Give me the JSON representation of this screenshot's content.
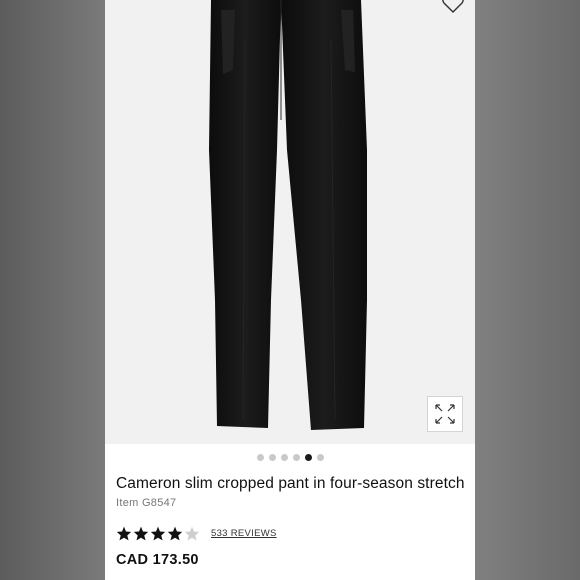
{
  "product": {
    "title": "Cameron slim cropped pant in four-season stretch",
    "item_number": "Item G8547",
    "rating": 4,
    "rating_max": 5,
    "reviews_label": "533 REVIEWS",
    "price": "CAD 173.50"
  },
  "gallery": {
    "image_count": 6,
    "active_index": 4
  },
  "icons": {
    "favorite": "heart-outline-icon",
    "expand": "expand-arrows-icon"
  },
  "colors": {
    "star_filled": "#111111",
    "star_empty": "#cfcfcf",
    "dot_active": "#1a1a1a",
    "dot_inactive": "#c9c9c9"
  }
}
